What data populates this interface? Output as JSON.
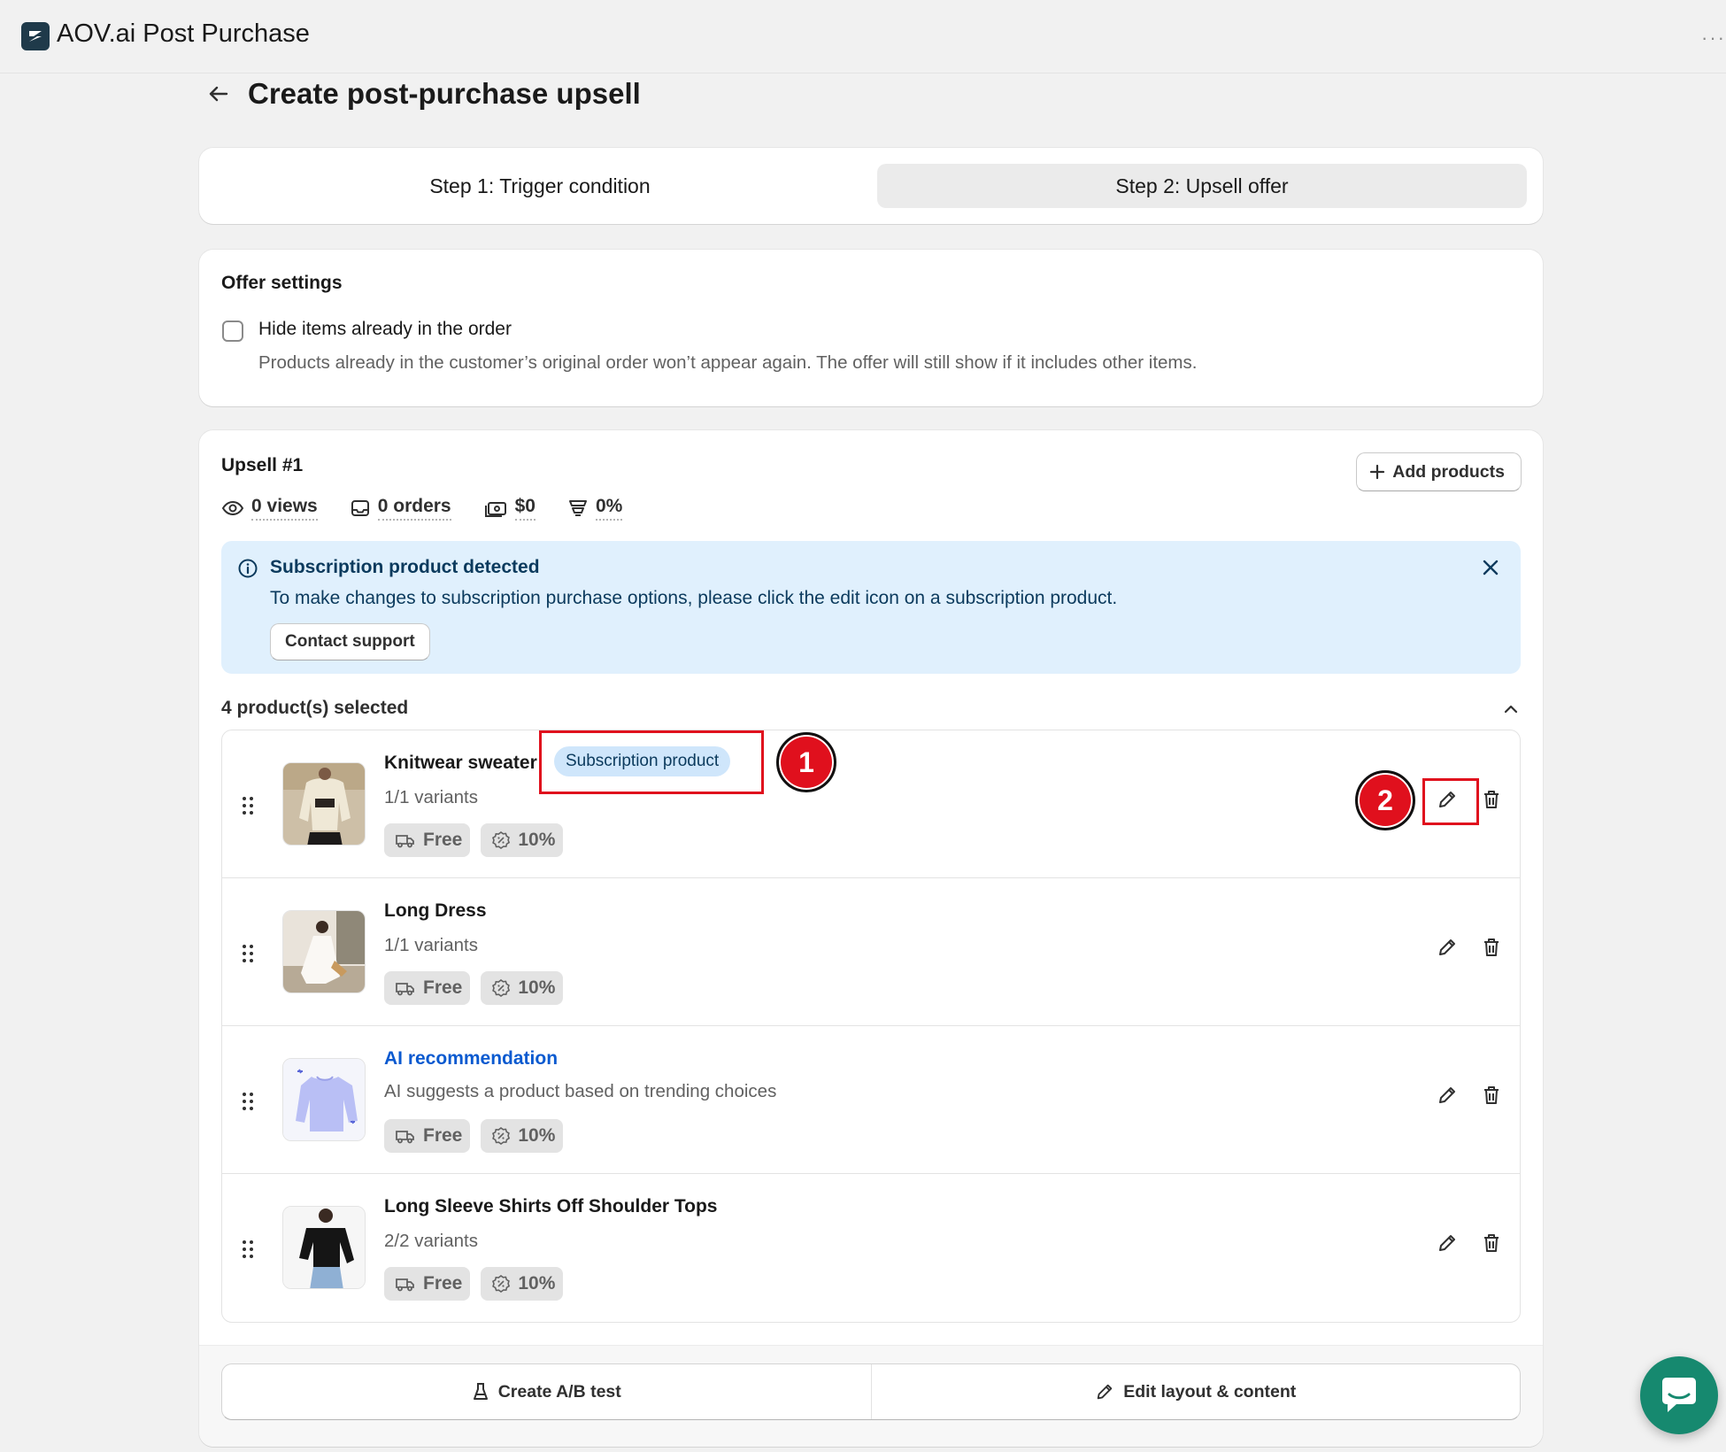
{
  "app": {
    "title": "AOV.ai Post Purchase",
    "more": "···"
  },
  "page": {
    "title": "Create post-purchase upsell"
  },
  "steps": [
    {
      "label": "Step 1: Trigger condition"
    },
    {
      "label": "Step 2: Upsell offer",
      "selected": true
    }
  ],
  "offer_settings": {
    "title": "Offer settings",
    "checkbox_label": "Hide items already in the order",
    "checkbox_checked": false,
    "help_text": "Products already in the customer’s original order won’t appear again. The offer will still show if it includes other items."
  },
  "upsell": {
    "title": "Upsell #1",
    "add_products_label": "Add products",
    "stats": {
      "views": "0 views",
      "orders": "0 orders",
      "revenue": "$0",
      "conversion": "0%"
    },
    "banner": {
      "title": "Subscription product detected",
      "text": "To make changes to subscription purchase options, please click the edit icon on a subscription product.",
      "button": "Contact support"
    },
    "selected_label": "4 product(s) selected",
    "products": [
      {
        "name": "Knitwear sweater",
        "sub": "1/1 variants",
        "badge": "Subscription product",
        "shipping": "Free",
        "discount": "10%"
      },
      {
        "name": "Long Dress",
        "sub": "1/1 variants",
        "shipping": "Free",
        "discount": "10%"
      },
      {
        "name": "AI recommendation",
        "sub": "AI suggests a product based on trending choices",
        "shipping": "Free",
        "discount": "10%"
      },
      {
        "name": "Long Sleeve Shirts Off Shoulder Tops",
        "sub": "2/2 variants",
        "shipping": "Free",
        "discount": "10%"
      }
    ],
    "footer": {
      "ab_test": "Create A/B test",
      "edit_layout": "Edit layout & content"
    }
  },
  "annotations": {
    "one": "1",
    "two": "2"
  },
  "colors": {
    "accent_red": "#e0101d",
    "banner_bg": "#e0f0fd",
    "link_blue": "#0a5ad0",
    "chat_green": "#16896f"
  }
}
